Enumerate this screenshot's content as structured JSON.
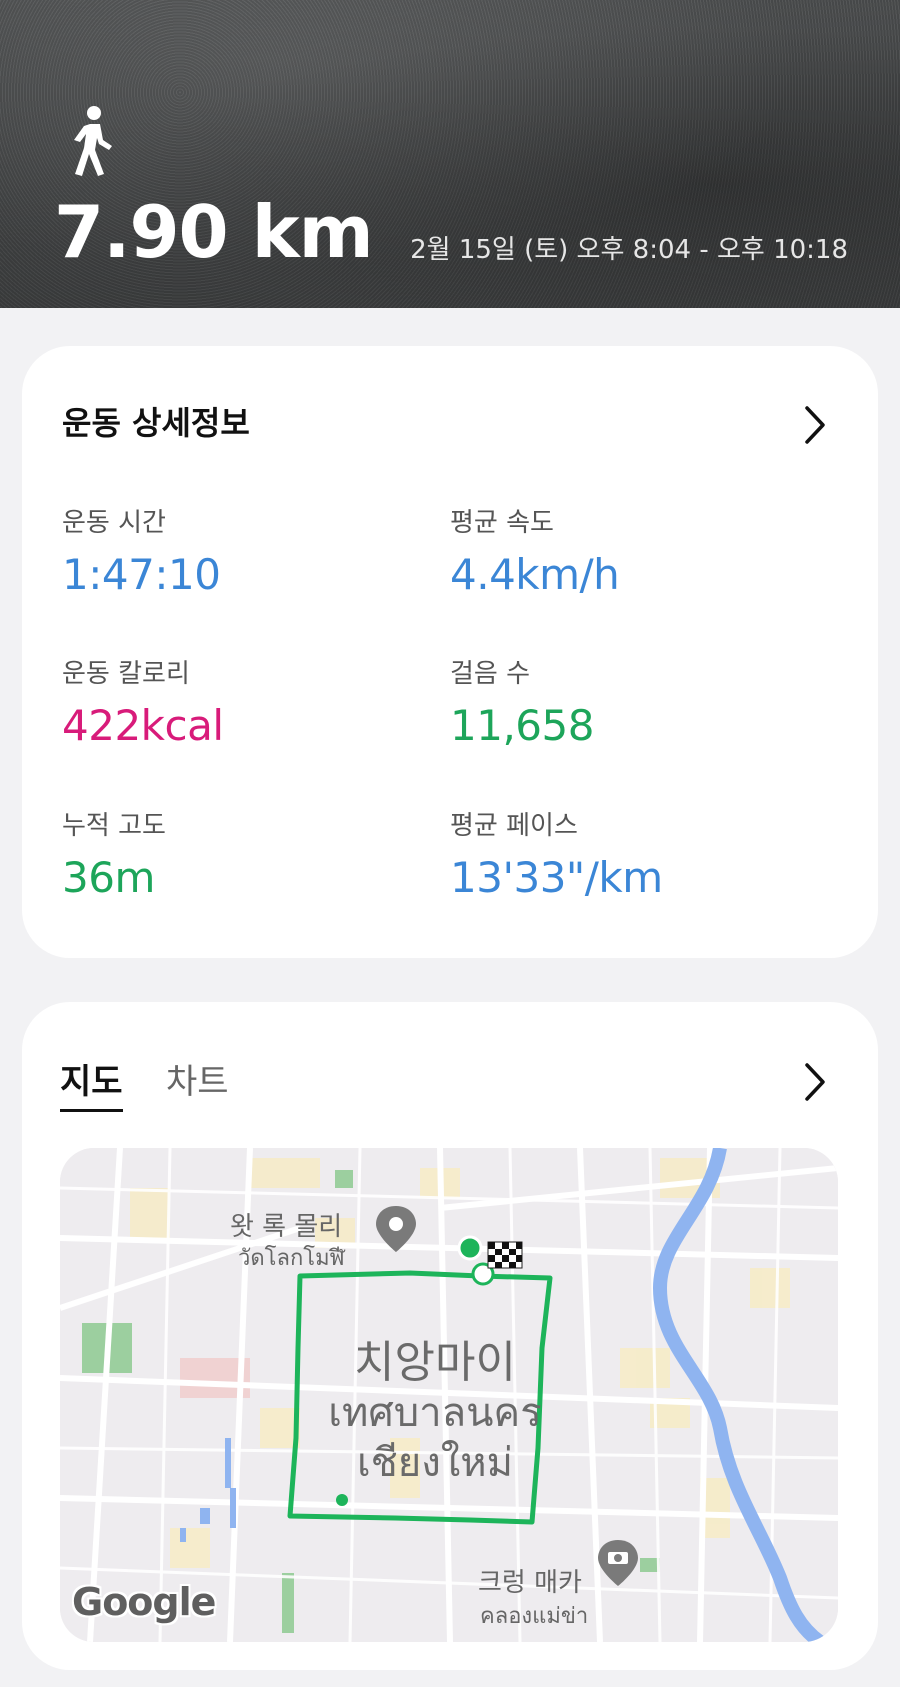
{
  "header": {
    "activity_icon": "walking-person-icon",
    "distance": "7.90 km",
    "datetime": "2월 15일 (토) 오후 8:04 - 오후 10:18"
  },
  "details": {
    "title": "운동 상세정보",
    "chevron_icon": "chevron-right-icon",
    "stats": {
      "duration": {
        "label": "운동 시간",
        "value": "1:47:10",
        "color": "#3b86d6"
      },
      "avg_speed": {
        "label": "평균 속도",
        "value": "4.4km/h",
        "color": "#3b86d6"
      },
      "calories": {
        "label": "운동 칼로리",
        "value": "422kcal",
        "color": "#d81b7a"
      },
      "steps": {
        "label": "걸음 수",
        "value": "11,658",
        "color": "#1da55a"
      },
      "elevation": {
        "label": "누적 고도",
        "value": "36m",
        "color": "#1da55a"
      },
      "avg_pace": {
        "label": "평균 페이스",
        "value": "13'33\"/km",
        "color": "#3b86d6"
      }
    }
  },
  "map_section": {
    "tabs": [
      {
        "label": "지도",
        "active": true
      },
      {
        "label": "차트",
        "active": false
      }
    ],
    "chevron_icon": "chevron-right-icon",
    "route_color": "#1db45a",
    "labels": {
      "wat_lok_molee_ko": "왓 록 몰리",
      "wat_lok_molee_th": "วัดโลกโมฬี",
      "city_ko": "치앙마이",
      "city_th_line1": "เทศบาลนคร",
      "city_th_line2": "เชียงใหม่",
      "khlong_ko": "크렁 매카",
      "khlong_th": "คลองแม่ข่า"
    },
    "google_logo": "Google"
  }
}
